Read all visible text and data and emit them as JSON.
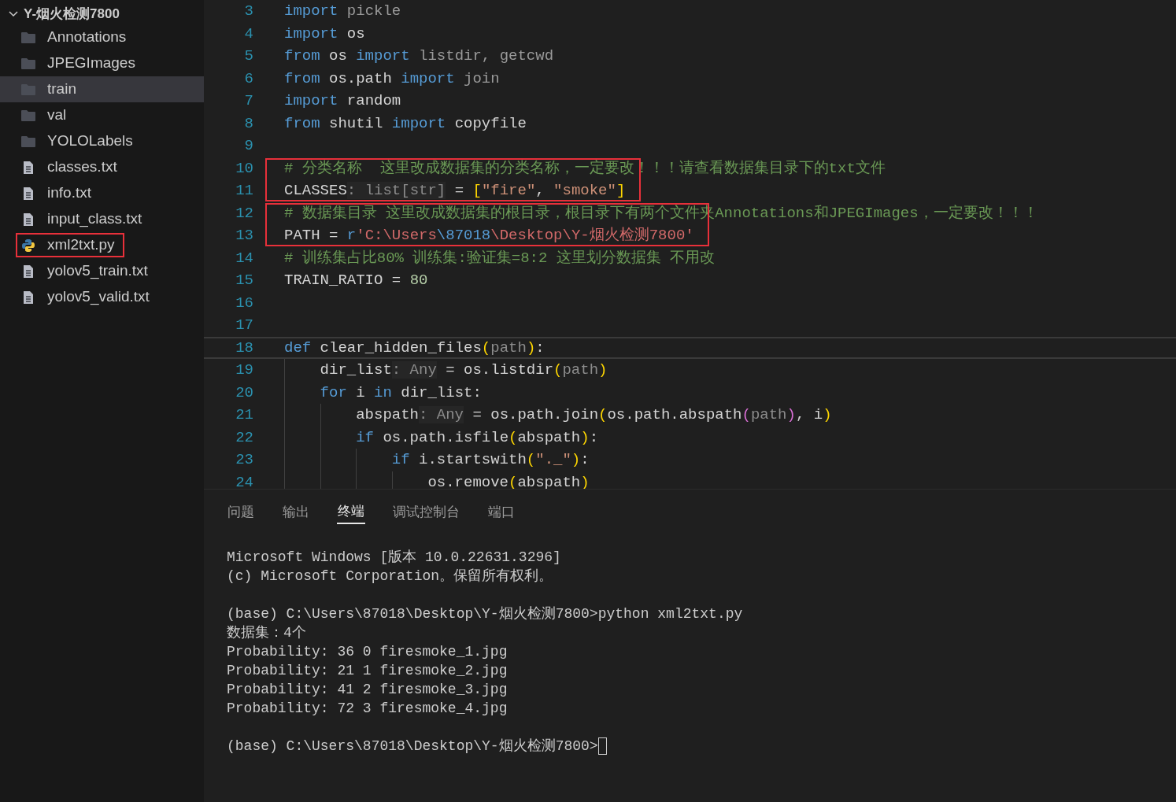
{
  "explorer": {
    "folder": "Y-烟火检测7800",
    "expanded": true,
    "items": [
      {
        "name": "Annotations",
        "kind": "folder",
        "selected": false,
        "marked": false
      },
      {
        "name": "JPEGImages",
        "kind": "folder",
        "selected": false,
        "marked": false
      },
      {
        "name": "train",
        "kind": "folder",
        "selected": true,
        "marked": false
      },
      {
        "name": "val",
        "kind": "folder",
        "selected": false,
        "marked": false
      },
      {
        "name": "YOLOLabels",
        "kind": "folder",
        "selected": false,
        "marked": false
      },
      {
        "name": "classes.txt",
        "kind": "file",
        "selected": false,
        "marked": false
      },
      {
        "name": "info.txt",
        "kind": "file",
        "selected": false,
        "marked": false
      },
      {
        "name": "input_class.txt",
        "kind": "file",
        "selected": false,
        "marked": false
      },
      {
        "name": "xml2txt.py",
        "kind": "python",
        "selected": false,
        "marked": true
      },
      {
        "name": "yolov5_train.txt",
        "kind": "file",
        "selected": false,
        "marked": false
      },
      {
        "name": "yolov5_valid.txt",
        "kind": "file",
        "selected": false,
        "marked": false
      }
    ]
  },
  "code": {
    "lines": [
      {
        "kind": "line",
        "number": "3",
        "current": false,
        "tokens": [
          {
            "t": "import",
            "kind": "kw"
          },
          {
            "t": " pickle",
            "kind": "dim"
          }
        ]
      },
      {
        "kind": "line",
        "number": "4",
        "current": false,
        "tokens": [
          {
            "t": "import",
            "kind": "kw"
          },
          {
            "t": " os",
            "kind": "id"
          }
        ]
      },
      {
        "kind": "line",
        "number": "5",
        "current": false,
        "tokens": [
          {
            "t": "from",
            "kind": "kw"
          },
          {
            "t": " os ",
            "kind": "id"
          },
          {
            "t": "import",
            "kind": "kw"
          },
          {
            "t": " listdir, getcwd",
            "kind": "dim"
          }
        ]
      },
      {
        "kind": "line",
        "number": "6",
        "current": false,
        "tokens": [
          {
            "t": "from",
            "kind": "kw"
          },
          {
            "t": " os.path ",
            "kind": "id"
          },
          {
            "t": "import",
            "kind": "kw"
          },
          {
            "t": " join",
            "kind": "dim"
          }
        ]
      },
      {
        "kind": "line",
        "number": "7",
        "current": false,
        "tokens": [
          {
            "t": "import",
            "kind": "kw"
          },
          {
            "t": " random",
            "kind": "id"
          }
        ]
      },
      {
        "kind": "line",
        "number": "8",
        "current": false,
        "tokens": [
          {
            "t": "from",
            "kind": "kw"
          },
          {
            "t": " shutil ",
            "kind": "id"
          },
          {
            "t": "import",
            "kind": "kw"
          },
          {
            "t": " copyfile",
            "kind": "id"
          }
        ]
      },
      {
        "kind": "line",
        "number": "9",
        "current": false
      },
      {
        "kind": "marked",
        "lines": [
          {
            "kind": "line",
            "number": "10",
            "current": false,
            "tokens": [
              {
                "t": "# 分类名称  这里改成数据集的分类名称，一定要改！！！请查看数据集目录下的txt文件",
                "kind": "cm"
              }
            ]
          },
          {
            "kind": "line",
            "number": "11",
            "current": false,
            "tokens": [
              {
                "t": "CLASSES",
                "kind": "id"
              },
              {
                "t": ": list[str]",
                "kind": "hint"
              },
              {
                "t": " = ",
                "kind": "id"
              },
              {
                "t": "[",
                "kind": "br1"
              },
              {
                "t": "\"fire\"",
                "kind": "str"
              },
              {
                "t": ", ",
                "kind": "id"
              },
              {
                "t": "\"smoke\"",
                "kind": "str"
              },
              {
                "t": "]",
                "kind": "br1"
              }
            ]
          }
        ]
      },
      {
        "kind": "marked",
        "lines": [
          {
            "kind": "line",
            "number": "12",
            "current": false,
            "tokens": [
              {
                "t": "# 数据集目录 这里改成数据集的根目录，根目录下有两个文件夹Annotations和JPEGImages，一定要改！！！",
                "kind": "cm"
              }
            ]
          },
          {
            "kind": "line",
            "number": "13",
            "current": false,
            "tokens": [
              {
                "t": "PATH",
                "kind": "id"
              },
              {
                "t": " = ",
                "kind": "id"
              },
              {
                "t": "r",
                "kind": "kw"
              },
              {
                "t": "'C:\\Users",
                "kind": "path"
              },
              {
                "t": "\\87018",
                "kind": "esc"
              },
              {
                "t": "\\Desktop\\Y-烟火检测7800'",
                "kind": "path"
              }
            ]
          }
        ]
      },
      {
        "kind": "line",
        "number": "14",
        "current": false,
        "tokens": [
          {
            "t": "# 训练集占比80% 训练集:验证集=8:2 这里划分数据集 不用改",
            "kind": "cm"
          }
        ]
      },
      {
        "kind": "line",
        "number": "15",
        "current": false,
        "tokens": [
          {
            "t": "TRAIN_RATIO",
            "kind": "id"
          },
          {
            "t": " = ",
            "kind": "id"
          },
          {
            "t": "80",
            "kind": "num"
          }
        ]
      },
      {
        "kind": "line",
        "number": "16",
        "current": false
      },
      {
        "kind": "line",
        "number": "17",
        "current": false
      },
      {
        "kind": "line",
        "number": "18",
        "current": true,
        "tokens": [
          {
            "t": "def",
            "kind": "kw"
          },
          {
            "t": " clear_hidden_files",
            "kind": "id"
          },
          {
            "t": "(",
            "kind": "br1"
          },
          {
            "t": "path",
            "kind": "param"
          },
          {
            "t": ")",
            "kind": "br1"
          },
          {
            "t": ":",
            "kind": "id"
          }
        ]
      },
      {
        "kind": "line",
        "number": "19",
        "current": false,
        "tokens": [
          {
            "t": "    dir_list",
            "kind": "id"
          },
          {
            "t": ": Any",
            "kind": "hint"
          },
          {
            "t": " = os.listdir",
            "kind": "id"
          },
          {
            "t": "(",
            "kind": "br1"
          },
          {
            "t": "path",
            "kind": "param"
          },
          {
            "t": ")",
            "kind": "br1"
          }
        ]
      },
      {
        "kind": "line",
        "number": "20",
        "current": false,
        "tokens": [
          {
            "t": "    for",
            "kind": "kw"
          },
          {
            "t": " i ",
            "kind": "id"
          },
          {
            "t": "in",
            "kind": "kw"
          },
          {
            "t": " dir_list:",
            "kind": "id"
          }
        ]
      },
      {
        "kind": "line",
        "number": "21",
        "current": false,
        "tokens": [
          {
            "t": "        abspath",
            "kind": "id"
          },
          {
            "t": ": Any",
            "kind": "hint"
          },
          {
            "t": " = os.path.join",
            "kind": "id"
          },
          {
            "t": "(",
            "kind": "br1"
          },
          {
            "t": "os.path.abspath",
            "kind": "id"
          },
          {
            "t": "(",
            "kind": "br2"
          },
          {
            "t": "path",
            "kind": "param"
          },
          {
            "t": ")",
            "kind": "br2"
          },
          {
            "t": ", i",
            "kind": "id"
          },
          {
            "t": ")",
            "kind": "br1"
          }
        ]
      },
      {
        "kind": "line",
        "number": "22",
        "current": false,
        "tokens": [
          {
            "t": "        if",
            "kind": "kw"
          },
          {
            "t": " os.path.isfile",
            "kind": "id"
          },
          {
            "t": "(",
            "kind": "br1"
          },
          {
            "t": "abspath",
            "kind": "id"
          },
          {
            "t": ")",
            "kind": "br1"
          },
          {
            "t": ":",
            "kind": "id"
          }
        ]
      },
      {
        "kind": "line",
        "number": "23",
        "current": false,
        "tokens": [
          {
            "t": "            if",
            "kind": "kw"
          },
          {
            "t": " i.startswith",
            "kind": "id"
          },
          {
            "t": "(",
            "kind": "br1"
          },
          {
            "t": "\"._\"",
            "kind": "str"
          },
          {
            "t": ")",
            "kind": "br1"
          },
          {
            "t": ":",
            "kind": "id"
          }
        ]
      },
      {
        "kind": "line",
        "number": "24",
        "current": false,
        "tokens": [
          {
            "t": "                os.remove",
            "kind": "id"
          },
          {
            "t": "(",
            "kind": "br1"
          },
          {
            "t": "abspath",
            "kind": "id"
          },
          {
            "t": ")",
            "kind": "br1"
          }
        ]
      }
    ]
  },
  "panel": {
    "tabs": [
      {
        "label": "问题",
        "selected": false
      },
      {
        "label": "输出",
        "selected": false
      },
      {
        "label": "终端",
        "selected": true
      },
      {
        "label": "调试控制台",
        "selected": false
      },
      {
        "label": "端口",
        "selected": false
      }
    ],
    "terminal": {
      "cursor": true,
      "blocks": [
        [
          "Microsoft Windows [版本 10.0.22631.3296]",
          "(c) Microsoft Corporation。保留所有权利。"
        ],
        [
          "(base) C:\\Users\\87018\\Desktop\\Y-烟火检测7800>python xml2txt.py",
          "数据集：4个",
          "Probability: 36 0 firesmoke_1.jpg",
          "Probability: 21 1 firesmoke_2.jpg",
          "Probability: 41 2 firesmoke_3.jpg",
          "Probability: 72 3 firesmoke_4.jpg"
        ],
        [
          "(base) C:\\Users\\87018\\Desktop\\Y-烟火检测7800>"
        ]
      ]
    }
  }
}
